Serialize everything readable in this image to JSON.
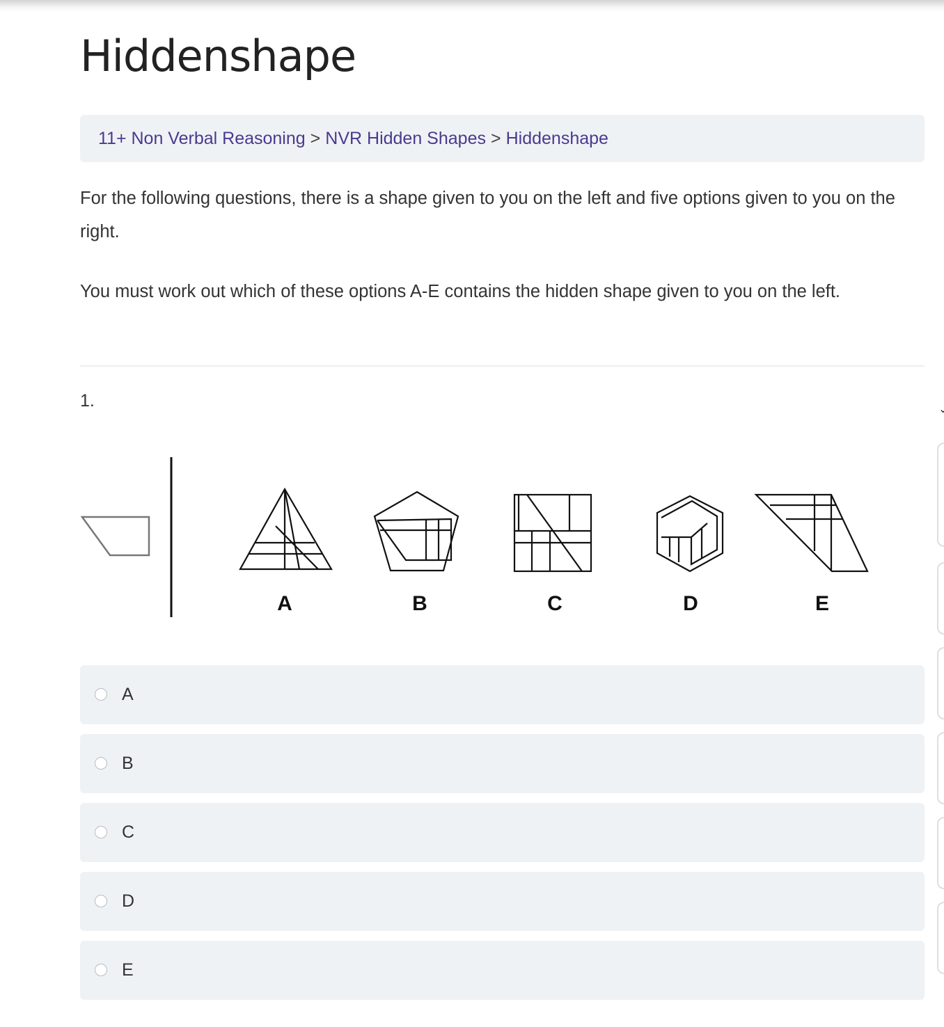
{
  "page": {
    "title": "Hiddenshape"
  },
  "breadcrumb": {
    "items": [
      "11+ Non Verbal Reasoning",
      "NVR Hidden Shapes",
      "Hiddenshape"
    ],
    "separator": ">"
  },
  "intro": {
    "paragraph1": "For the following questions, there is a shape given to you on the left and five options given to you on the right.",
    "paragraph2": "You must work out which of these options A-E contains the hidden shape given to you on the left."
  },
  "question": {
    "number": "1.",
    "figure_labels": [
      "A",
      "B",
      "C",
      "D",
      "E"
    ],
    "options": [
      {
        "label": "A"
      },
      {
        "label": "B"
      },
      {
        "label": "C"
      },
      {
        "label": "D"
      },
      {
        "label": "E"
      }
    ]
  },
  "colors": {
    "link": "#4a3a8f",
    "panel_background": "#eff2f5",
    "text": "#333333"
  }
}
